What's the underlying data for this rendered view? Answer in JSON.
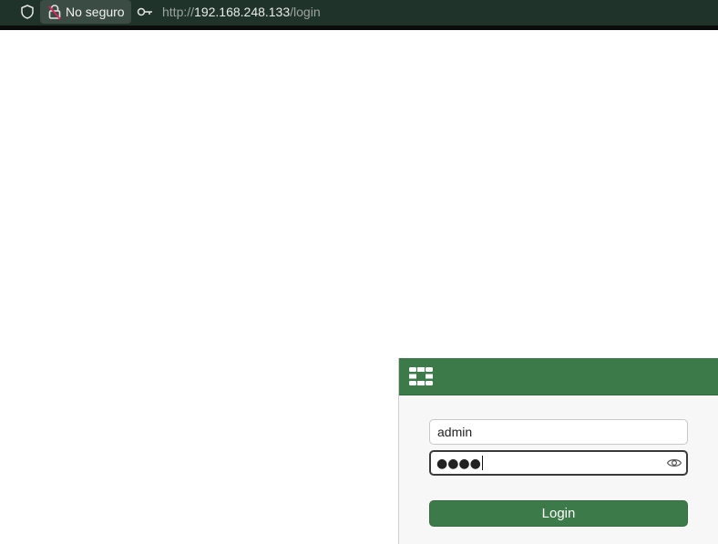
{
  "browser": {
    "security_label": "No seguro",
    "url": {
      "scheme": "http://",
      "host": "192.168.248.133",
      "path": "/login"
    },
    "icons": {
      "shield": "shield-icon",
      "lock": "lock-warning-icon",
      "key": "key-icon"
    }
  },
  "login": {
    "username_value": "admin",
    "password_masked": "●●●●",
    "button_label": "Login",
    "icons": {
      "logo": "fortinet-logo-icon",
      "reveal": "eye-icon"
    },
    "colors": {
      "brand": "#3d7a4a",
      "browser_bar": "#20332b"
    }
  }
}
